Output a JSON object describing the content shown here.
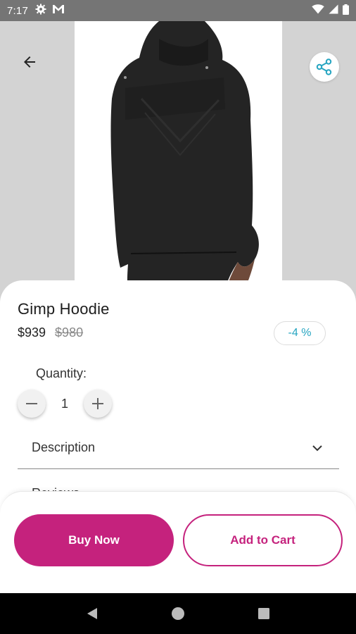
{
  "status_bar": {
    "time": "7:17",
    "left_icons": [
      "settings-icon",
      "gmail-icon"
    ],
    "right_icons": [
      "wifi-icon",
      "signal-icon",
      "battery-icon"
    ]
  },
  "hero": {
    "back_icon": "arrow-back-icon",
    "share_icon": "share-icon",
    "image_alt": "product-photo",
    "share_color": "#26a5c1"
  },
  "product": {
    "title": "Gimp Hoodie",
    "price": "$939",
    "original_price": "$980",
    "discount": "-4 %"
  },
  "quantity": {
    "label": "Quantity:",
    "value": "1",
    "decrement_icon": "minus-icon",
    "increment_icon": "plus-icon"
  },
  "description": {
    "label": "Description",
    "chevron_icon": "chevron-down-icon"
  },
  "reviews": {
    "label": "Reviews"
  },
  "actions": {
    "buy_label": "Buy Now",
    "cart_label": "Add to Cart",
    "accent_color": "#c5227d"
  },
  "nav": {
    "back_icon": "nav-back-icon",
    "home_icon": "nav-home-icon",
    "recents_icon": "nav-recents-icon"
  }
}
